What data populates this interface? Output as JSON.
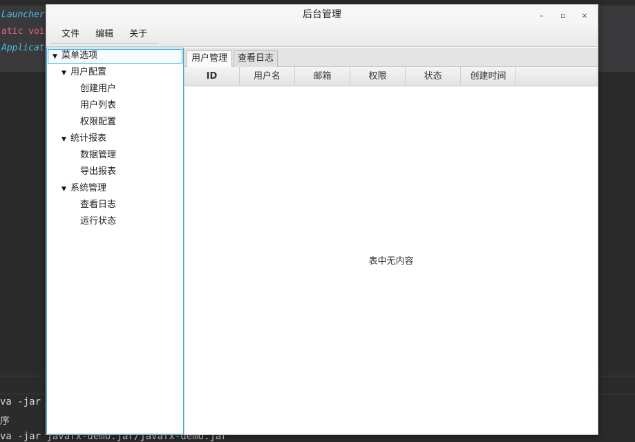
{
  "ide": {
    "code_lines": [
      "Launcher",
      "atic voi",
      "Applicat"
    ],
    "terminal_lines": [
      "va -jar J",
      "序",
      "va -jar javafx-demo.jar/javafx-demo.jar"
    ]
  },
  "window": {
    "title": "后台管理",
    "controls": {
      "minimize": "–",
      "maximize": "▫",
      "close": "×"
    }
  },
  "menubar": {
    "items": [
      "文件",
      "编辑",
      "关于"
    ]
  },
  "tree": {
    "root": "菜单选项",
    "groups": [
      {
        "label": "用户配置",
        "children": [
          "创建用户",
          "用户列表",
          "权限配置"
        ]
      },
      {
        "label": "统计报表",
        "children": [
          "数据管理",
          "导出报表"
        ]
      },
      {
        "label": "系统管理",
        "children": [
          "查看日志",
          "运行状态"
        ]
      }
    ]
  },
  "tabs": [
    {
      "label": "用户管理",
      "active": true
    },
    {
      "label": "查看日志",
      "active": false
    }
  ],
  "table": {
    "columns": [
      "ID",
      "用户名",
      "邮箱",
      "权限",
      "状态",
      "创建时间"
    ],
    "empty_message": "表中无内容"
  },
  "colors": {
    "accent": "#3aa7d6",
    "code_blue": "#4fc1e9",
    "code_red": "#f06080"
  }
}
